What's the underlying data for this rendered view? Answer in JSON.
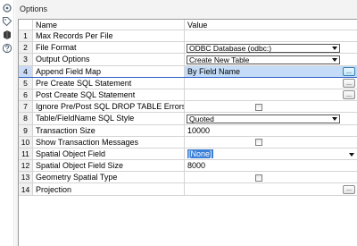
{
  "panel": {
    "title": "Options"
  },
  "toolbar": {
    "icons": [
      "settings-icon",
      "tag-icon",
      "annotation-icon",
      "help-icon"
    ]
  },
  "grid": {
    "header": {
      "name": "Name",
      "value": "Value"
    },
    "rows": [
      {
        "num": "1",
        "name": "Max Records Per File",
        "value": "",
        "editor": "text"
      },
      {
        "num": "2",
        "name": "File Format",
        "value": "ODBC Database (odbc:)",
        "editor": "dropdown"
      },
      {
        "num": "3",
        "name": "Output Options",
        "value": "Create New Table",
        "editor": "dropdown"
      },
      {
        "num": "4",
        "name": "Append Field Map",
        "value": "By Field Name",
        "editor": "ellipsis",
        "selected": true
      },
      {
        "num": "5",
        "name": "Pre Create SQL Statement",
        "value": "",
        "editor": "ellipsis"
      },
      {
        "num": "6",
        "name": "Post Create SQL Statement",
        "value": "",
        "editor": "ellipsis"
      },
      {
        "num": "7",
        "name": "Ignore Pre/Post SQL DROP TABLE Errors",
        "value": "",
        "editor": "checkbox",
        "checked": false
      },
      {
        "num": "8",
        "name": "Table/FieldName SQL Style",
        "value": "Quoted",
        "editor": "dropdown"
      },
      {
        "num": "9",
        "name": "Transaction Size",
        "value": "10000",
        "editor": "text"
      },
      {
        "num": "10",
        "name": "Show Transaction Messages",
        "value": "",
        "editor": "checkbox",
        "checked": false
      },
      {
        "num": "11",
        "name": "Spatial Object Field",
        "value": "[None]",
        "editor": "plain-dropdown"
      },
      {
        "num": "12",
        "name": "Spatial Object Field Size",
        "value": "8000",
        "editor": "text"
      },
      {
        "num": "13",
        "name": "Geometry Spatial Type",
        "value": "",
        "editor": "checkbox",
        "checked": false
      },
      {
        "num": "14",
        "name": "Projection",
        "value": "",
        "editor": "ellipsis"
      }
    ],
    "ellipsis_label": "..."
  },
  "colors": {
    "selection": "#c4dcf7",
    "selection_border": "#2b5ec7",
    "text_highlight": "#3a7fd6"
  }
}
